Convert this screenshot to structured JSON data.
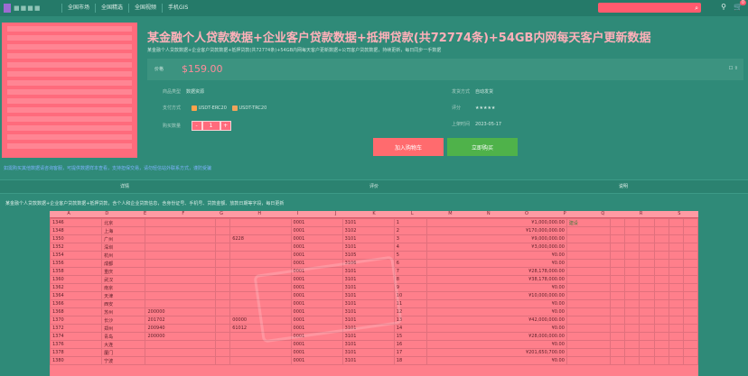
{
  "nav": [
    "全国市场",
    "全国精选",
    "全国视频",
    "手机GIS"
  ],
  "top_icons": {
    "user": "user-icon",
    "cart": "cart-icon",
    "cart_count": "0"
  },
  "title": "某金融个人贷款数据+企业客户贷款数据+抵押贷款(共72774条)+54GB内网每天客户更新数据",
  "subtitle": "某金融个人贷款数据+企业客户贷款数据+抵押贷款(共72774条)+54GB内网每天客户更新数据+公司客户贷款数据，持续更新，每日同步一手数据",
  "price": {
    "label": "价格",
    "value": "$159.00"
  },
  "info": {
    "left": [
      {
        "k": "商品类型",
        "v": "数据资源"
      },
      {
        "k": "支付方式",
        "v1": "USDT-ERC20",
        "v2": "USDT-TRC20"
      },
      {
        "k": "购买数量",
        "qty": "1"
      }
    ],
    "right": [
      {
        "k": "发货方式",
        "v": "自动发货"
      },
      {
        "k": "评分",
        "v": "★★★★★"
      },
      {
        "k": "上架时间",
        "v": "2023-05-17"
      }
    ]
  },
  "buttons": {
    "add_cart": "加入购物车",
    "buy": "立即购买"
  },
  "notice": "如需购买其他数据请咨询客服，可提供数据样本查看，支持担保交易，请勿轻信站外联系方式，谨防受骗",
  "tabs": [
    "详情",
    "评价",
    "说明"
  ],
  "description": "某金融个人贷款数据+企业客户贷款数据+抵押贷款，含个人和企业贷款信息，含身份证号、手机号、贷款金额、放款日期等字段，每日更新",
  "sheet": {
    "columns": [
      "A",
      "D",
      "E",
      "F",
      "G",
      "H",
      "I",
      "J",
      "K",
      "L",
      "M",
      "N",
      "O",
      "P",
      "Q",
      "R",
      "S"
    ],
    "rows": [
      [
        "1346",
        "北京",
        "",
        "",
        "",
        "0001",
        "3101",
        "1",
        "¥1,000,000.00",
        "建设",
        "",
        "",
        "",
        "",
        "",
        ""
      ],
      [
        "1348",
        "上海",
        "",
        "",
        "",
        "0001",
        "3102",
        "2",
        "¥170,000,000.00",
        "",
        "",
        "",
        "",
        "",
        "",
        ""
      ],
      [
        "1350",
        "广州",
        "",
        "",
        "6228",
        "0001",
        "3101",
        "3",
        "¥9,000,000.00",
        "",
        "",
        "",
        "",
        "",
        "",
        ""
      ],
      [
        "1352",
        "深圳",
        "",
        "",
        "",
        "0001",
        "3101",
        "4",
        "¥3,000,000.00",
        "",
        "",
        "",
        "",
        "",
        "",
        ""
      ],
      [
        "1354",
        "杭州",
        "",
        "",
        "",
        "0001",
        "3105",
        "5",
        "¥0.00",
        "",
        "",
        "",
        "",
        "",
        "",
        ""
      ],
      [
        "1356",
        "成都",
        "",
        "",
        "",
        "0001",
        "3106",
        "6",
        "¥0.00",
        "",
        "",
        "",
        "",
        "",
        "",
        ""
      ],
      [
        "1358",
        "重庆",
        "",
        "",
        "",
        "0001",
        "3101",
        "7",
        "¥28,178,000.00",
        "",
        "",
        "",
        "",
        "",
        "",
        ""
      ],
      [
        "1360",
        "武汉",
        "",
        "",
        "",
        "0001",
        "3101",
        "8",
        "¥38,178,000.00",
        "",
        "",
        "",
        "",
        "",
        "",
        ""
      ],
      [
        "1362",
        "南京",
        "",
        "",
        "",
        "0001",
        "3101",
        "9",
        "¥0.00",
        "",
        "",
        "",
        "",
        "",
        "",
        ""
      ],
      [
        "1364",
        "天津",
        "",
        "",
        "",
        "0001",
        "3101",
        "10",
        "¥10,000,000.00",
        "",
        "",
        "",
        "",
        "",
        "",
        ""
      ],
      [
        "1366",
        "西安",
        "",
        "",
        "",
        "0001",
        "3101",
        "11",
        "¥0.00",
        "",
        "",
        "",
        "",
        "",
        "",
        ""
      ],
      [
        "1368",
        "苏州",
        "200000",
        "",
        "",
        "0001",
        "3101",
        "12",
        "¥0.00",
        "",
        "",
        "",
        "",
        "",
        "",
        ""
      ],
      [
        "1370",
        "长沙",
        "201702",
        "",
        "00000",
        "0001",
        "3101",
        "13",
        "¥42,000,000.00",
        "",
        "",
        "",
        "",
        "",
        "",
        ""
      ],
      [
        "1372",
        "郑州",
        "200940",
        "",
        "61012",
        "0001",
        "3101",
        "14",
        "¥0.00",
        "",
        "",
        "",
        "",
        "",
        "",
        ""
      ],
      [
        "1374",
        "青岛",
        "200000",
        "",
        "",
        "0001",
        "3101",
        "15",
        "¥28,000,000.00",
        "",
        "",
        "",
        "",
        "",
        "",
        ""
      ],
      [
        "1376",
        "大连",
        "",
        "",
        "",
        "0001",
        "3101",
        "16",
        "¥0.00",
        "",
        "",
        "",
        "",
        "",
        "",
        ""
      ],
      [
        "1378",
        "厦门",
        "",
        "",
        "",
        "0001",
        "3101",
        "17",
        "¥201,650,700.00",
        "",
        "",
        "",
        "",
        "",
        "",
        ""
      ],
      [
        "1380",
        "宁波",
        "",
        "",
        "",
        "0001",
        "3101",
        "18",
        "¥0.00",
        "",
        "",
        "",
        "",
        "",
        "",
        ""
      ]
    ]
  }
}
